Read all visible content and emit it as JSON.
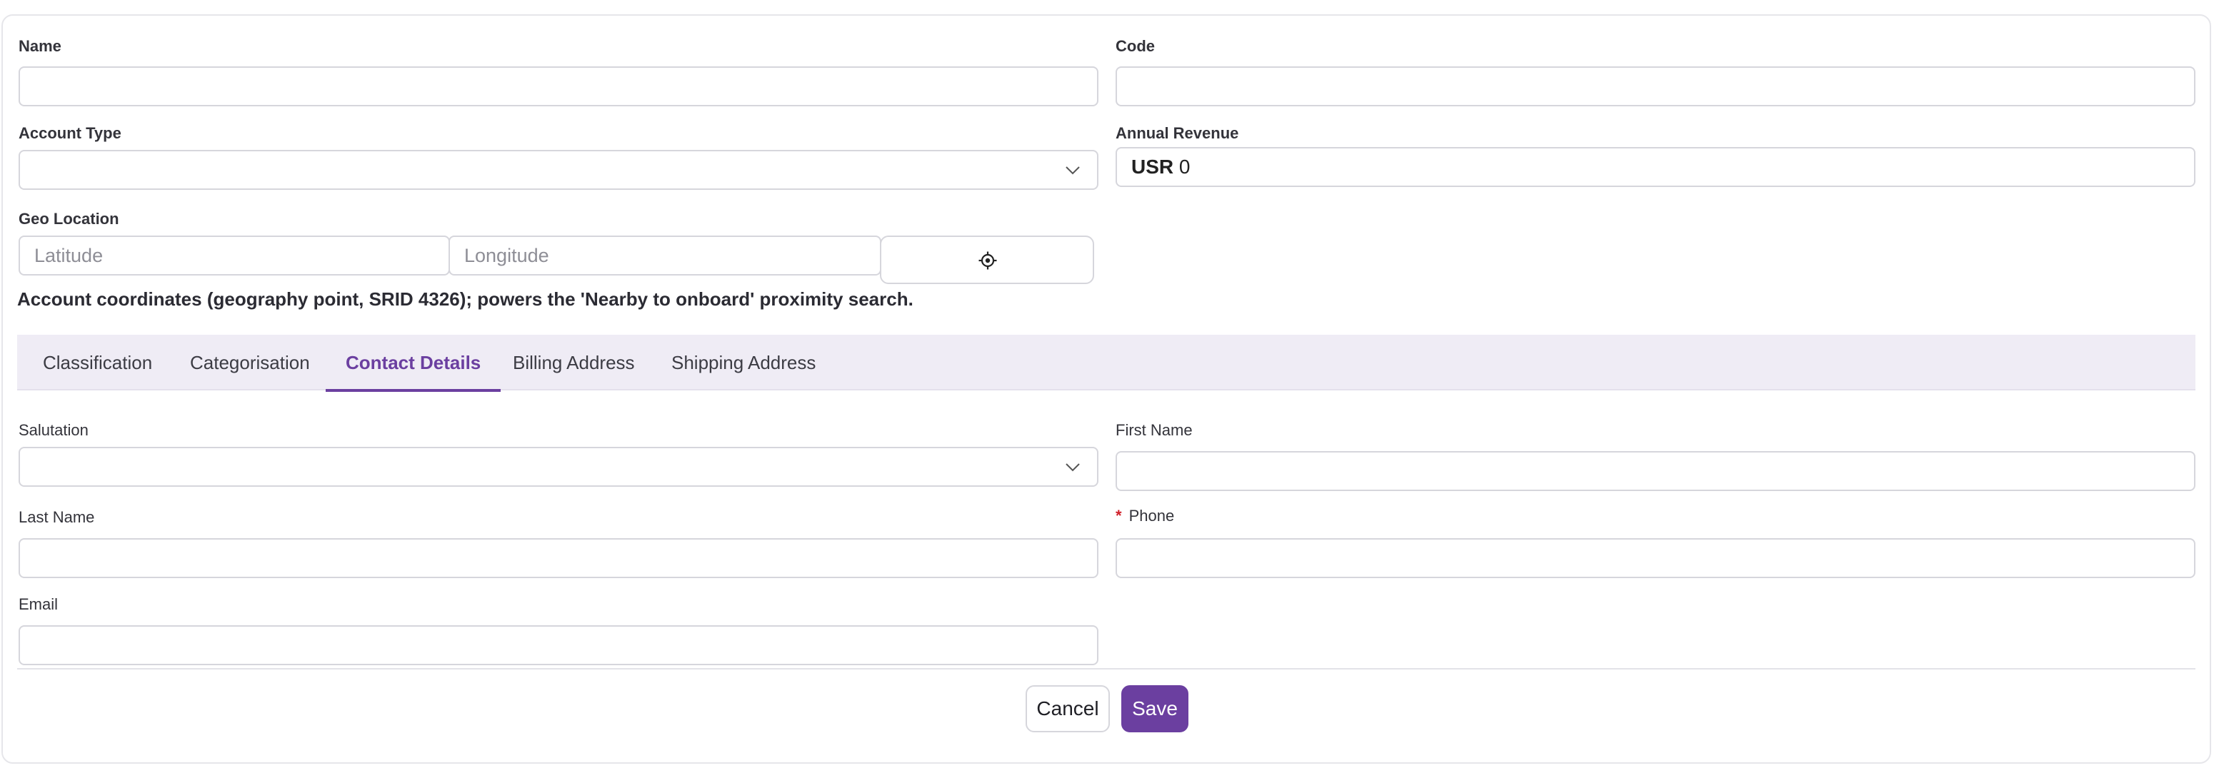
{
  "form": {
    "name_label": "Name",
    "name_value": "",
    "code_label": "Code",
    "code_value": "",
    "account_type_label": "Account Type",
    "account_type_value": "",
    "annual_revenue_label": "Annual Revenue",
    "annual_revenue_currency": "USR",
    "annual_revenue_value": "0",
    "geo_location_label": "Geo Location",
    "latitude_placeholder": "Latitude",
    "longitude_placeholder": "Longitude",
    "geo_hint": "Account coordinates (geography point, SRID 4326); powers the 'Nearby to onboard' proximity search."
  },
  "tabs": [
    {
      "label": "Classification",
      "active": false
    },
    {
      "label": "Categorisation",
      "active": false
    },
    {
      "label": "Contact Details",
      "active": true
    },
    {
      "label": "Billing Address",
      "active": false
    },
    {
      "label": "Shipping Address",
      "active": false
    }
  ],
  "contact": {
    "salutation_label": "Salutation",
    "salutation_value": "",
    "first_name_label": "First Name",
    "first_name_value": "",
    "last_name_label": "Last Name",
    "last_name_value": "",
    "phone_required_mark": "*",
    "phone_label": "Phone",
    "phone_value": "",
    "email_label": "Email",
    "email_value": ""
  },
  "actions": {
    "cancel_label": "Cancel",
    "save_label": "Save"
  },
  "colors": {
    "accent": "#6b3fa0",
    "tab_bar_bg": "#efecf5",
    "required": "#d0202a"
  },
  "icons": {
    "select_chevron": "chevron-down-icon",
    "locate": "crosshair-icon"
  }
}
